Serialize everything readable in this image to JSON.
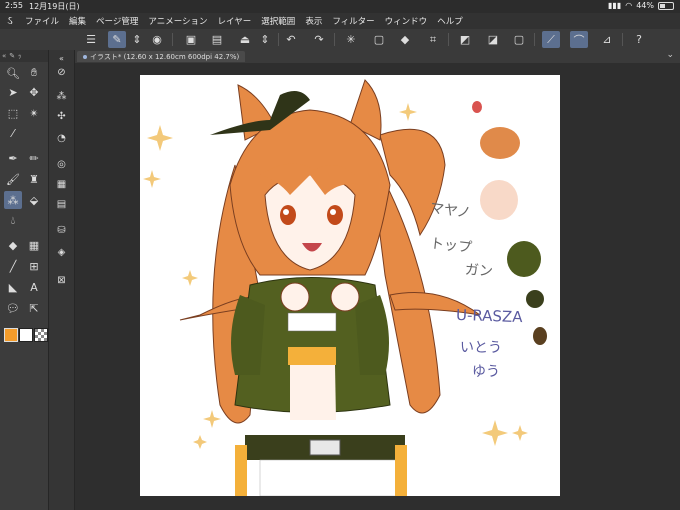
{
  "status": {
    "time": "2:55",
    "date": "12月19日(日)",
    "battery": "44%",
    "battery_level": 0.44
  },
  "menu": [
    "ファイル",
    "編集",
    "ページ管理",
    "アニメーション",
    "レイヤー",
    "選択範囲",
    "表示",
    "フィルター",
    "ウィンドウ",
    "ヘルプ"
  ],
  "document": {
    "tab_label": "イラスト* (12.60 x 12.60cm 600dpi 42.7%)"
  },
  "canvas_text": {
    "line1": "マヤノ",
    "line2": "トップ",
    "line3": "ガン",
    "line4": "U-RASZA",
    "line5": "いとう",
    "line6": "ゆう"
  },
  "colors": {
    "accent": "#5c6f8f",
    "palette": [
      "#d9534f",
      "#e08a4a",
      "#f8d9c8",
      "#4d5a1e",
      "#3a3f1c",
      "#5a4020"
    ],
    "main_color": "#f39c2b",
    "sub_color": "#ffffff"
  },
  "icons": {
    "menu": "☰",
    "file-new": "▣",
    "folder": "▤",
    "save": "⇩",
    "undo": "↶",
    "redo": "↷",
    "loading": "✳",
    "fill": "◆",
    "transform": "⌗",
    "pen": "✎",
    "hand": "✋",
    "help": "?"
  }
}
